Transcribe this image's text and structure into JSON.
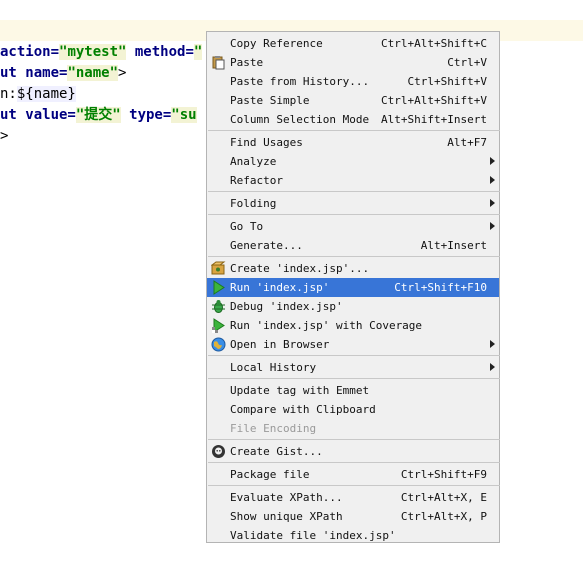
{
  "editor": {
    "lines": [
      {
        "pre": "action=",
        "str": "\"mytest\"",
        "mid": " method=",
        "str2": "\""
      },
      {
        "pre": "ut name=",
        "str": "\"name\"",
        "post": ">"
      },
      {
        "pre": "n:",
        "el": "${name}"
      },
      {
        "pre": "ut value=",
        "str": "\"提交\"",
        "mid": " type=",
        "str2": "\"su"
      },
      {
        "post": ">"
      }
    ]
  },
  "menu": {
    "items": [
      {
        "label": "Copy Reference",
        "shortcut": "Ctrl+Alt+Shift+C"
      },
      {
        "label": "Paste",
        "shortcut": "Ctrl+V",
        "icon": "clipboard-icon"
      },
      {
        "label": "Paste from History...",
        "shortcut": "Ctrl+Shift+V"
      },
      {
        "label": "Paste Simple",
        "shortcut": "Ctrl+Alt+Shift+V"
      },
      {
        "label": "Column Selection Mode",
        "shortcut": "Alt+Shift+Insert"
      },
      {
        "label": "Find Usages",
        "shortcut": "Alt+F7"
      },
      {
        "label": "Analyze",
        "submenu": true
      },
      {
        "label": "Refactor",
        "submenu": true
      },
      {
        "label": "Folding",
        "submenu": true
      },
      {
        "label": "Go To",
        "submenu": true
      },
      {
        "label": "Generate...",
        "shortcut": "Alt+Insert"
      },
      {
        "label": "Create 'index.jsp'...",
        "icon": "run-config-icon"
      },
      {
        "label": "Run 'index.jsp'",
        "shortcut": "Ctrl+Shift+F10",
        "icon": "run-icon",
        "selected": true
      },
      {
        "label": "Debug 'index.jsp'",
        "icon": "debug-icon"
      },
      {
        "label": "Run 'index.jsp' with Coverage",
        "icon": "coverage-icon"
      },
      {
        "label": "Open in Browser",
        "submenu": true,
        "icon": "globe-icon"
      },
      {
        "label": "Local History",
        "submenu": true
      },
      {
        "label": "Update tag with Emmet"
      },
      {
        "label": "Compare with Clipboard"
      },
      {
        "label": "File Encoding",
        "disabled": true
      },
      {
        "label": "Create Gist...",
        "icon": "github-icon"
      },
      {
        "label": "Package file",
        "shortcut": "Ctrl+Shift+F9"
      },
      {
        "label": "Evaluate XPath...",
        "shortcut": "Ctrl+Alt+X, E"
      },
      {
        "label": "Show unique XPath",
        "shortcut": "Ctrl+Alt+X, P"
      },
      {
        "label": "Validate file 'index.jsp'"
      }
    ]
  },
  "colors": {
    "selection": "#3875d7",
    "string": "#008000",
    "keyword": "#000080"
  }
}
